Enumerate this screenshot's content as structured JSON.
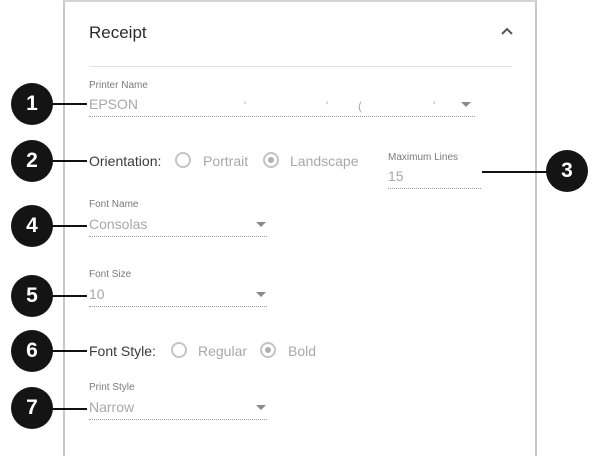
{
  "section": {
    "title": "Receipt",
    "collapse_icon": "chevron-up-icon"
  },
  "printer": {
    "label": "Printer Name",
    "value": "EPSON"
  },
  "orientation": {
    "label": "Orientation:",
    "options": [
      "Portrait",
      "Landscape"
    ],
    "selected": "Landscape"
  },
  "max_lines": {
    "label": "Maximum Lines",
    "value": "15"
  },
  "font_name": {
    "label": "Font Name",
    "value": "Consolas"
  },
  "font_size": {
    "label": "Font Size",
    "value": "10"
  },
  "font_style": {
    "label": "Font Style:",
    "options": [
      "Regular",
      "Bold"
    ],
    "selected": "Bold"
  },
  "print_style": {
    "label": "Print Style",
    "value": "Narrow"
  },
  "callouts": [
    "1",
    "2",
    "3",
    "4",
    "5",
    "6",
    "7"
  ],
  "colors": {
    "callout": "#141414",
    "panel_border": "#c9c9c9",
    "muted_text": "#a8a8a8"
  }
}
